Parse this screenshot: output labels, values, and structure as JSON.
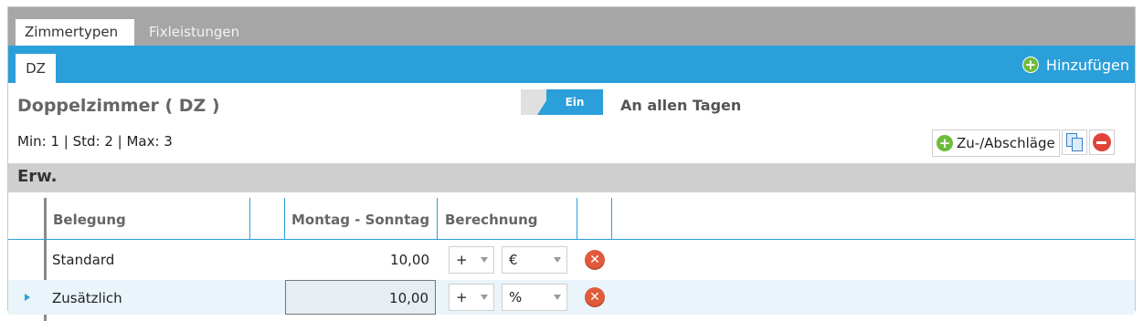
{
  "tabs": {
    "active": "Zimmertypen",
    "inactive": "Fixleistungen"
  },
  "subtab": "DZ",
  "add_button": "Hinzufügen",
  "room": {
    "title": "Doppelzimmer  ( DZ )",
    "toggle_state": "Ein",
    "toggle_label": "An allen Tagen",
    "minmax": "Min:  1  |  Std:  2  |  Max:  3"
  },
  "surcharge_button": "Zu-/Abschläge",
  "section_title": "Erw.",
  "grid": {
    "columns": [
      "Belegung",
      "Montag - Sonntag",
      "Berechnung"
    ],
    "rows": [
      {
        "name": "Standard",
        "value": "10,00",
        "op": "+",
        "unit": "€"
      },
      {
        "name": "Zusätzlich",
        "value": "10,00",
        "op": "+",
        "unit": "%"
      }
    ]
  },
  "colors": {
    "accent": "#2b9fd9",
    "add_green": "#6dbb3c",
    "delete_red": "#e05a3c",
    "tabbar_gray": "#a6a6a6"
  }
}
